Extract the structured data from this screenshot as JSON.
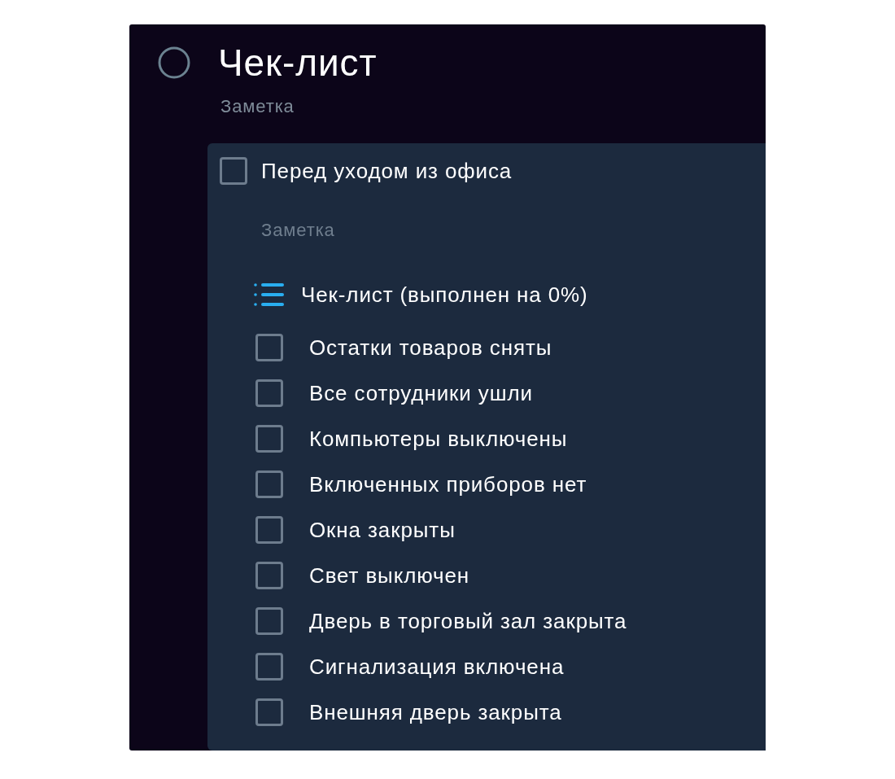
{
  "task": {
    "done": false,
    "title": "Чек-лист",
    "note": {
      "placeholder": "Заметка"
    }
  },
  "subtask": {
    "checked": false,
    "title": "Перед уходом из офиса",
    "note": {
      "placeholder": "Заметка"
    }
  },
  "checklist": {
    "title": "Чек-лист (выполнен на 0%)",
    "items": [
      {
        "label": "Остатки товаров сняты",
        "checked": false
      },
      {
        "label": "Все сотрудники ушли",
        "checked": false
      },
      {
        "label": "Компьютеры выключены",
        "checked": false
      },
      {
        "label": "Включенных приборов нет",
        "checked": false
      },
      {
        "label": "Окна закрыты",
        "checked": false
      },
      {
        "label": "Свет выключен",
        "checked": false
      },
      {
        "label": "Дверь в торговый зал закрыта",
        "checked": false
      },
      {
        "label": "Сигнализация включена",
        "checked": false
      },
      {
        "label": "Внешняя дверь закрыта",
        "checked": false
      }
    ]
  }
}
